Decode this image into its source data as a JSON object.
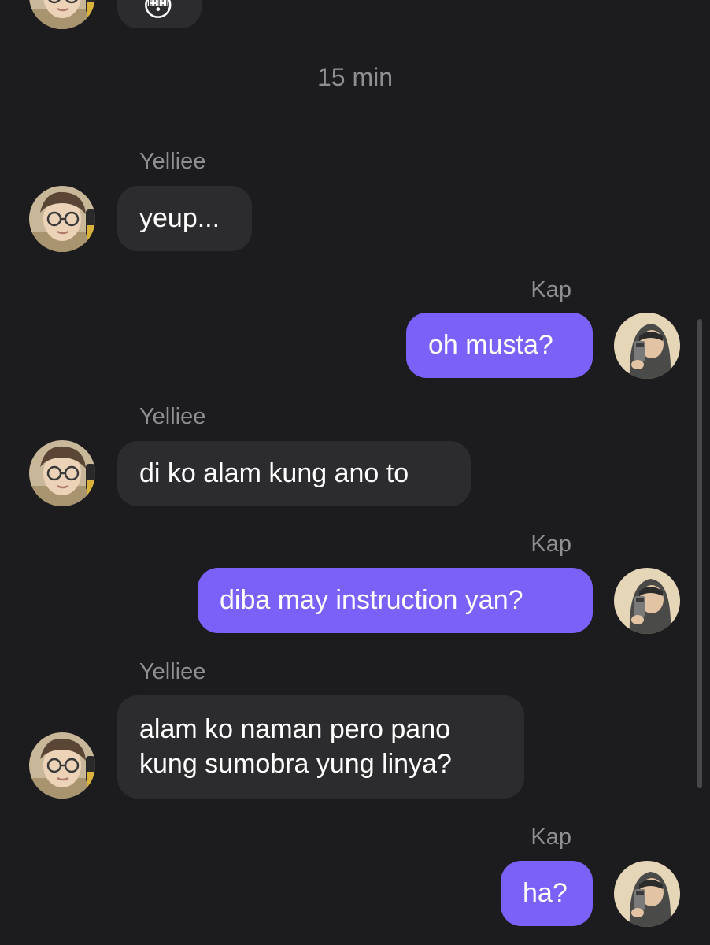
{
  "conversation": {
    "timestamp": "15 min",
    "messages": [
      {
        "sender": "Yelliee",
        "direction": "incoming",
        "lines": [
          "yeup..."
        ]
      },
      {
        "sender": "Kap",
        "direction": "outgoing",
        "lines": [
          "oh musta?"
        ]
      },
      {
        "sender": "Yelliee",
        "direction": "incoming",
        "lines": [
          "di ko alam kung ano to"
        ]
      },
      {
        "sender": "Kap",
        "direction": "outgoing",
        "lines": [
          "diba may instruction yan?"
        ]
      },
      {
        "sender": "Yelliee",
        "direction": "incoming",
        "lines": [
          "alam ko naman pero pano",
          "kung sumobra yung linya?"
        ]
      },
      {
        "sender": "Kap",
        "direction": "outgoing",
        "lines": [
          "ha?"
        ]
      }
    ]
  },
  "top_partial": {
    "emoji": "😳",
    "emoji_icon": "flushed-face-emoji-icon"
  },
  "colors": {
    "background": "#1c1c1e",
    "incoming_bubble": "#2c2c2e",
    "outgoing_bubble": "#7b61f8",
    "secondary_text": "#8e8e93"
  }
}
